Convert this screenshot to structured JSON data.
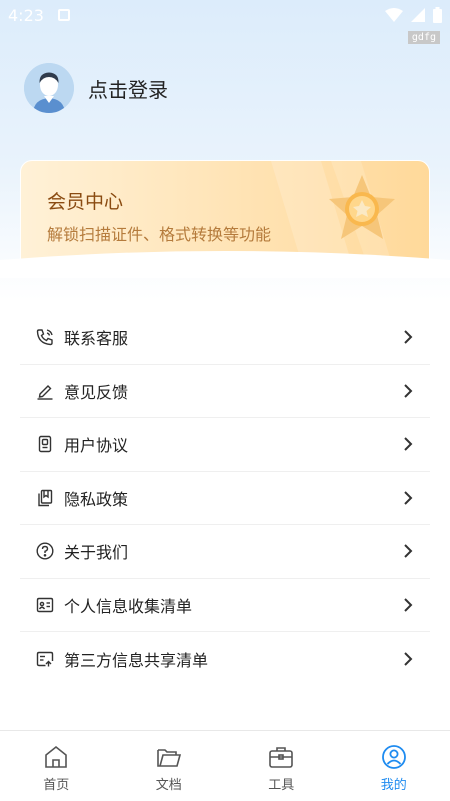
{
  "status_bar": {
    "time": "4:23"
  },
  "debug_tag": "gdfg",
  "profile": {
    "login_text": "点击登录"
  },
  "vip": {
    "title": "会员中心",
    "subtitle": "解锁扫描证件、格式转换等功能"
  },
  "menu": {
    "items": [
      {
        "label": "联系客服",
        "icon": "phone-icon"
      },
      {
        "label": "意见反馈",
        "icon": "edit-icon"
      },
      {
        "label": "用户协议",
        "icon": "agreement-icon"
      },
      {
        "label": "隐私政策",
        "icon": "privacy-icon"
      },
      {
        "label": "关于我们",
        "icon": "question-icon"
      },
      {
        "label": "个人信息收集清单",
        "icon": "id-card-icon"
      },
      {
        "label": "第三方信息共享清单",
        "icon": "share-card-icon"
      }
    ]
  },
  "tabs": [
    {
      "label": "首页",
      "icon": "home-icon",
      "active": false
    },
    {
      "label": "文档",
      "icon": "folder-icon",
      "active": false
    },
    {
      "label": "工具",
      "icon": "toolbox-icon",
      "active": false
    },
    {
      "label": "我的",
      "icon": "user-icon",
      "active": true
    }
  ],
  "colors": {
    "accent": "#1e8bf0",
    "vip_title": "#8a4b11",
    "vip_subtitle": "#b57b3c"
  }
}
